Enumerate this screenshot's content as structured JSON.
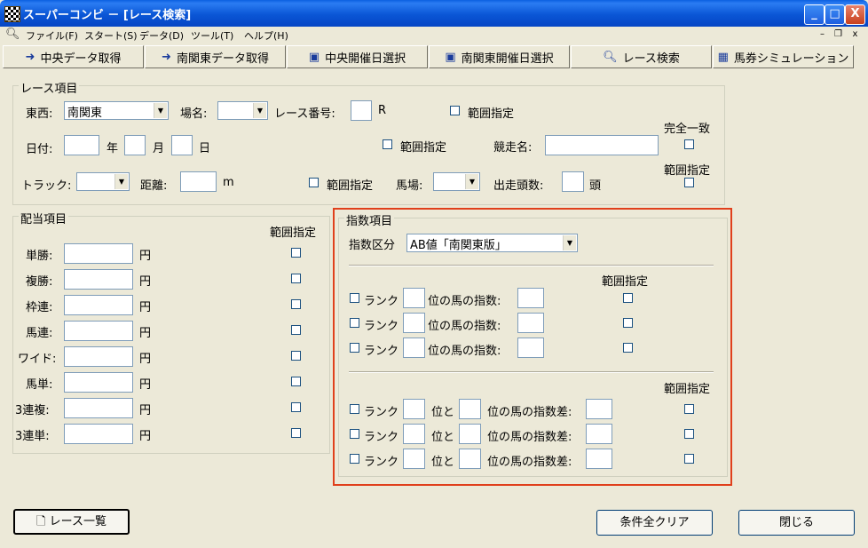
{
  "window": {
    "title": "スーパーコンビ － [レース検索]"
  },
  "title_buttons": {
    "minimize": "_",
    "maximize": "□",
    "close": "X"
  },
  "menu": [
    "ファイル(F)",
    "スタート(S)",
    "データ(D)",
    "ツール(T)",
    "ヘルプ(H)"
  ],
  "mdi_buttons": {
    "minimize": "–",
    "restore": "❐",
    "close": "x"
  },
  "toolbar": [
    "中央データ取得",
    "南関東データ取得",
    "中央開催日選択",
    "南関東開催日選択",
    "レース検索",
    "馬券シミュレーション"
  ],
  "race_group": {
    "title": "レース項目",
    "tozai_label": "東西:",
    "tozai_value": "南関東",
    "place_label": "場名:",
    "race_no_label": "レース番号:",
    "race_no_unit": "R",
    "range_label": "範囲指定",
    "date_label": "日付:",
    "year": "年",
    "month": "月",
    "day": "日",
    "horse_name_label": "競走名:",
    "exact_match_label": "完全一致",
    "track_label": "トラック:",
    "distance_label": "距離:",
    "distance_unit": "m",
    "condition_label": "馬場:",
    "starters_label": "出走頭数:",
    "starters_unit": "頭"
  },
  "payout_group": {
    "title": "配当項目",
    "range_label": "範囲指定",
    "unit": "円",
    "rows": [
      "単勝:",
      "複勝:",
      "枠連:",
      "馬連:",
      "ワイド:",
      "馬単:",
      "3連複:",
      "3連単:"
    ]
  },
  "index_group": {
    "title": "指数項目",
    "kubun_label": "指数区分",
    "kubun_value": "AB値「南関東版」",
    "range_label": "範囲指定",
    "rank_label": "ランク",
    "single_suffix": "位の馬の指数:",
    "pair_mid": "位と",
    "diff_suffix": "位の馬の指数差:"
  },
  "footer": {
    "race_list": "レース一覧",
    "clear_all": "条件全クリア",
    "close": "閉じる"
  },
  "highlight_color": "#e0401c"
}
